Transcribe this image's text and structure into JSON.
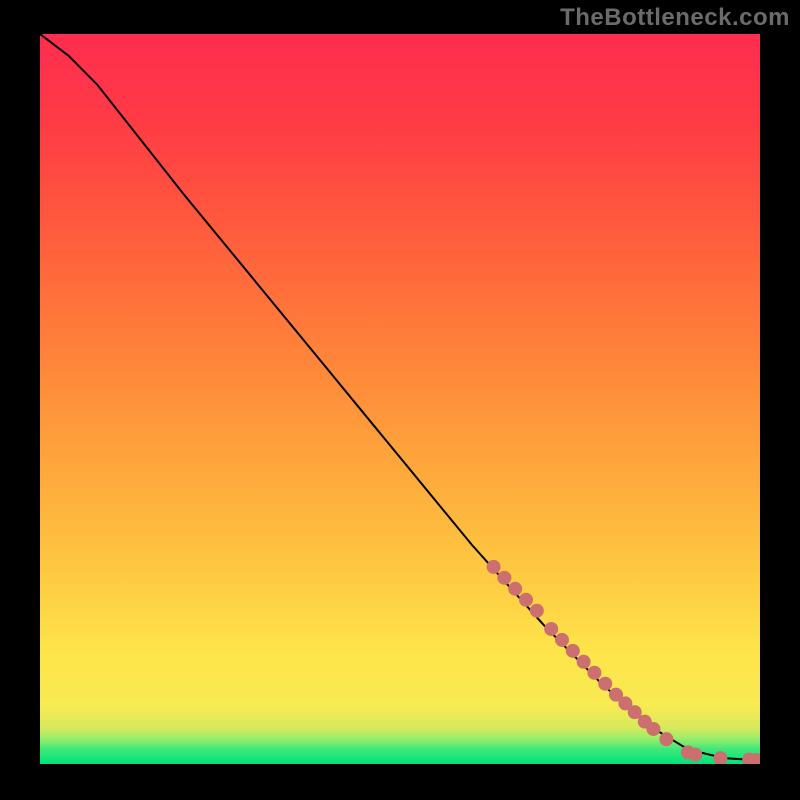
{
  "watermark": "TheBottleneck.com",
  "chart_data": {
    "type": "line",
    "title": "",
    "xlabel": "",
    "ylabel": "",
    "xlim": [
      0,
      100
    ],
    "ylim": [
      0,
      100
    ],
    "grid": false,
    "legend": false,
    "gradient_stops": [
      {
        "offset": 0.0,
        "color": "#00e17b"
      },
      {
        "offset": 0.02,
        "color": "#3de97a"
      },
      {
        "offset": 0.035,
        "color": "#9bed6a"
      },
      {
        "offset": 0.05,
        "color": "#d9e95c"
      },
      {
        "offset": 0.08,
        "color": "#f7ea52"
      },
      {
        "offset": 0.15,
        "color": "#fee54a"
      },
      {
        "offset": 0.3,
        "color": "#fec03f"
      },
      {
        "offset": 0.45,
        "color": "#fe9d3b"
      },
      {
        "offset": 0.6,
        "color": "#ff7a3a"
      },
      {
        "offset": 0.75,
        "color": "#ff573e"
      },
      {
        "offset": 0.88,
        "color": "#ff3b45"
      },
      {
        "offset": 1.0,
        "color": "#ff2d4f"
      }
    ],
    "line": {
      "color": "#000000",
      "width": 2,
      "points": [
        {
          "x": 0,
          "y": 100
        },
        {
          "x": 4,
          "y": 97
        },
        {
          "x": 8,
          "y": 93
        },
        {
          "x": 12,
          "y": 88
        },
        {
          "x": 20,
          "y": 78
        },
        {
          "x": 30,
          "y": 66
        },
        {
          "x": 40,
          "y": 54
        },
        {
          "x": 50,
          "y": 42
        },
        {
          "x": 60,
          "y": 30
        },
        {
          "x": 70,
          "y": 19
        },
        {
          "x": 78,
          "y": 11
        },
        {
          "x": 85,
          "y": 5
        },
        {
          "x": 90,
          "y": 2
        },
        {
          "x": 95,
          "y": 0.8
        },
        {
          "x": 100,
          "y": 0.5
        }
      ]
    },
    "marker_segments": {
      "color_fill": "#cc6f6f",
      "color_stroke": "#cc6f6f",
      "radius": 7,
      "groups": [
        [
          {
            "x": 63,
            "y": 27
          },
          {
            "x": 64.5,
            "y": 25.5
          },
          {
            "x": 66,
            "y": 24
          },
          {
            "x": 67.5,
            "y": 22.5
          },
          {
            "x": 69,
            "y": 21
          }
        ],
        [
          {
            "x": 71,
            "y": 18.5
          },
          {
            "x": 72.5,
            "y": 17
          },
          {
            "x": 74,
            "y": 15.5
          },
          {
            "x": 75.5,
            "y": 14
          },
          {
            "x": 77,
            "y": 12.5
          },
          {
            "x": 78.5,
            "y": 11
          }
        ],
        [
          {
            "x": 80,
            "y": 9.5
          },
          {
            "x": 81.3,
            "y": 8.3
          },
          {
            "x": 82.6,
            "y": 7.1
          }
        ],
        [
          {
            "x": 84,
            "y": 5.8
          },
          {
            "x": 85.2,
            "y": 4.8
          }
        ],
        [
          {
            "x": 87,
            "y": 3.4
          }
        ],
        [
          {
            "x": 90,
            "y": 1.6
          },
          {
            "x": 91,
            "y": 1.3
          }
        ],
        [
          {
            "x": 94.5,
            "y": 0.8
          }
        ],
        [
          {
            "x": 98.5,
            "y": 0.6
          },
          {
            "x": 99.5,
            "y": 0.55
          }
        ]
      ]
    }
  }
}
